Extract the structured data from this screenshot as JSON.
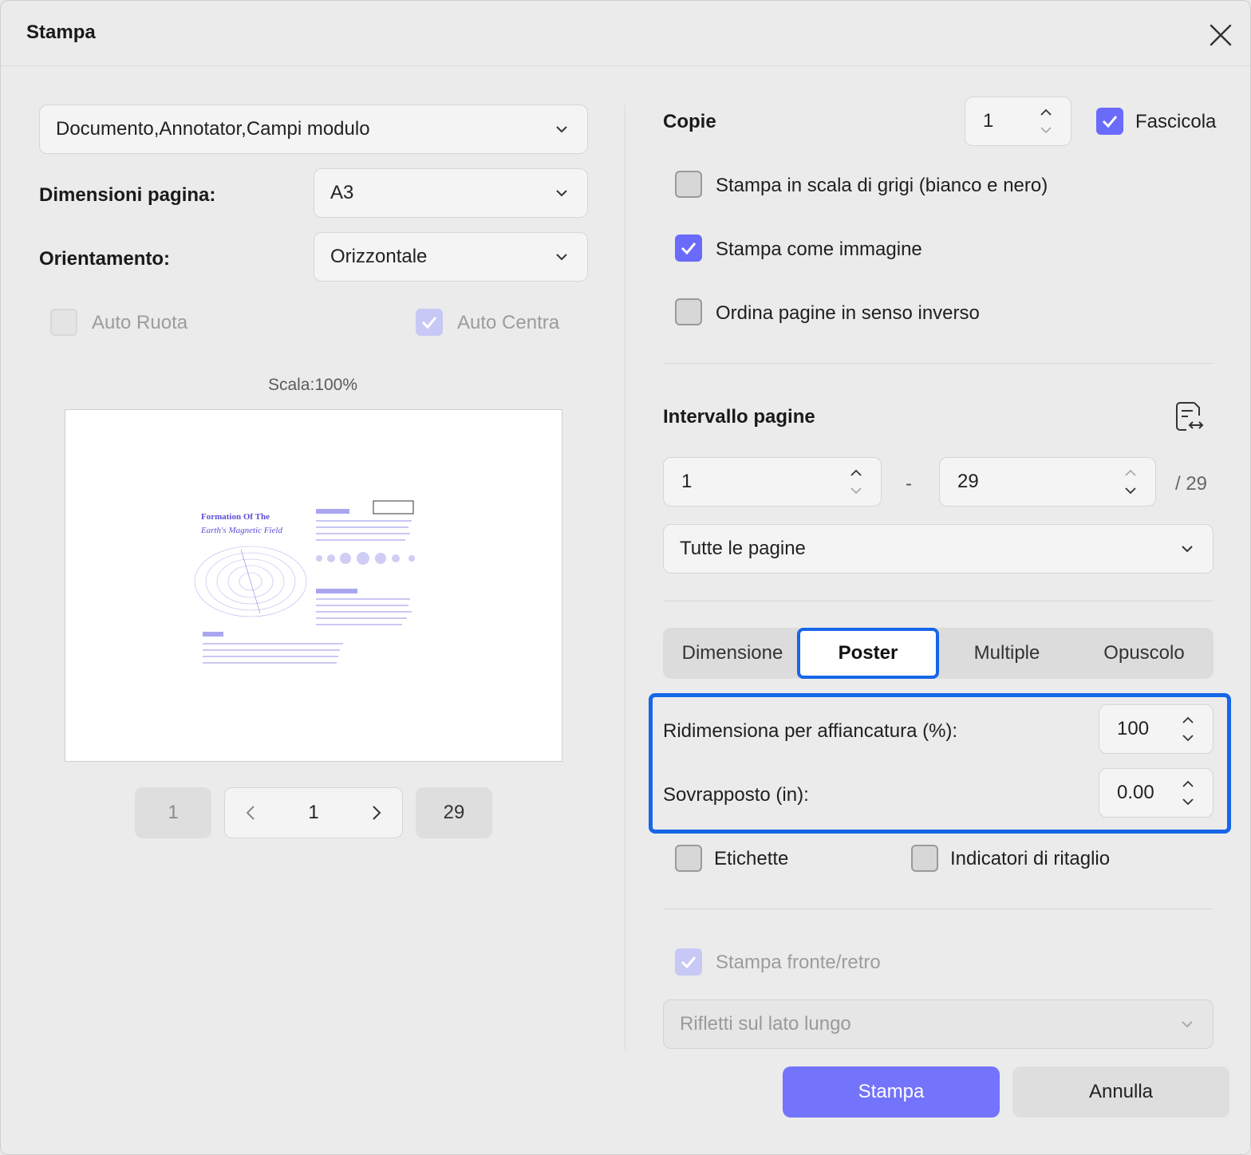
{
  "dialog": {
    "title": "Stampa"
  },
  "left": {
    "content_select": "Documento,Annotator,Campi modulo",
    "page_size": {
      "label": "Dimensioni pagina:",
      "value": "A3"
    },
    "orientation": {
      "label": "Orientamento:",
      "value": "Orizzontale"
    },
    "auto_rotate": {
      "label": "Auto Ruota",
      "checked": false,
      "disabled": true
    },
    "auto_center": {
      "label": "Auto Centra",
      "checked": true,
      "disabled": true
    },
    "scale": "Scala:100%",
    "preview": {
      "title_line1": "Formation Of The",
      "title_line2": "Earth's Magnetic Field"
    },
    "pager": {
      "first": "1",
      "current": "1",
      "last": "29"
    }
  },
  "right": {
    "copies": {
      "label": "Copie",
      "value": "1"
    },
    "collate": {
      "label": "Fascicola",
      "checked": true
    },
    "grayscale": {
      "label": "Stampa in scala di grigi (bianco e nero)",
      "checked": false
    },
    "as_image": {
      "label": "Stampa come immagine",
      "checked": true
    },
    "reverse": {
      "label": "Ordina pagine in senso inverso",
      "checked": false
    },
    "range": {
      "label": "Intervallo pagine",
      "from": "1",
      "separator": "-",
      "to": "29",
      "total": "/ 29",
      "subset": "Tutte le pagine"
    },
    "tabs": [
      {
        "label": "Dimensione"
      },
      {
        "label": "Poster"
      },
      {
        "label": "Multiple"
      },
      {
        "label": "Opuscolo"
      }
    ],
    "poster": {
      "tile_scale": {
        "label": "Ridimensiona per affiancatura (%):",
        "value": "100"
      },
      "overlap": {
        "label": "Sovrapposto (in):",
        "value": "0.00"
      },
      "labels": {
        "label": "Etichette",
        "checked": false
      },
      "crop_marks": {
        "label": "Indicatori di ritaglio",
        "checked": false
      }
    },
    "duplex": {
      "label": "Stampa fronte/retro",
      "checked": true,
      "disabled": true
    },
    "flip": "Rifletti sul lato lungo"
  },
  "actions": {
    "print": "Stampa",
    "cancel": "Annulla"
  },
  "colors": {
    "accent": "#6a6afb",
    "focus": "#1666e8"
  }
}
